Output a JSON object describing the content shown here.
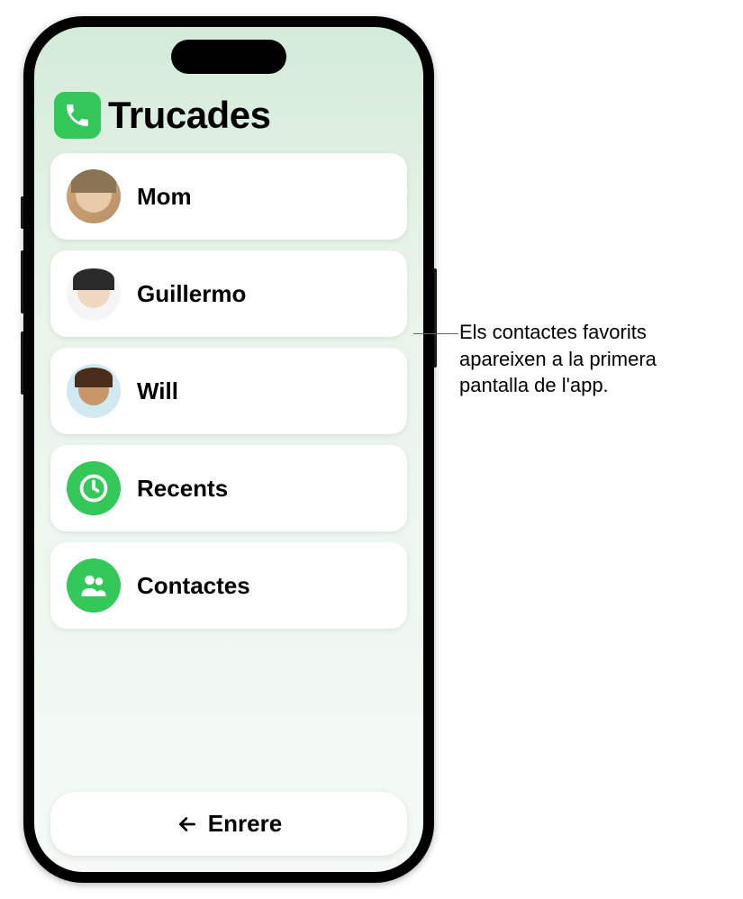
{
  "header": {
    "title": "Trucades",
    "icon": "phone-icon"
  },
  "favorites": [
    {
      "name": "Mom",
      "avatar": "mom"
    },
    {
      "name": "Guillermo",
      "avatar": "guillermo"
    },
    {
      "name": "Will",
      "avatar": "will"
    }
  ],
  "nav_items": [
    {
      "label": "Recents",
      "icon": "clock-icon"
    },
    {
      "label": "Contactes",
      "icon": "contacts-icon"
    }
  ],
  "back_button": {
    "label": "Enrere"
  },
  "callout": {
    "text": "Els contactes favorits apareixen a la primera pantalla de l'app."
  }
}
